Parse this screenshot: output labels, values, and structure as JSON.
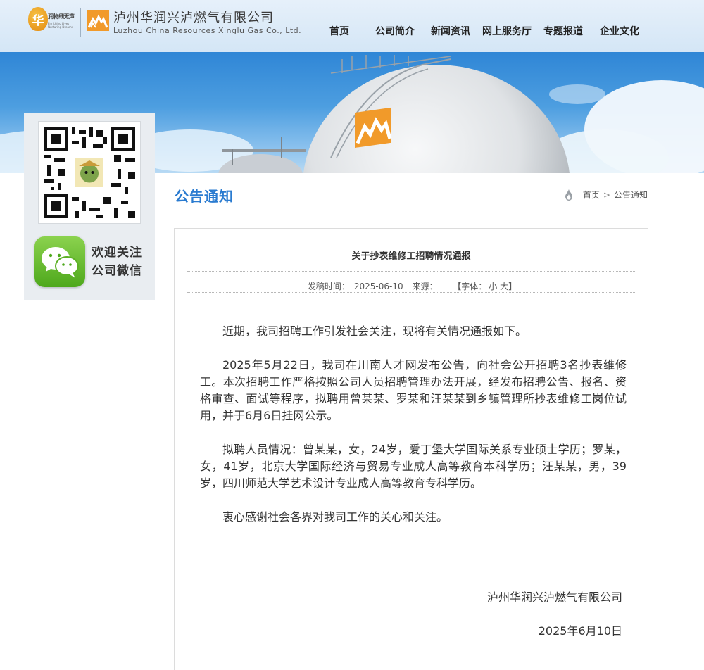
{
  "header": {
    "partner_logo_text": "润物细无声",
    "partner_logo_sub": "Enriching Lives Nurturing Dreams",
    "partner_badge_char": "华",
    "company_name_cn": "泸州华润兴泸燃气有限公司",
    "company_name_en": "Luzhou China Resources Xinglu Gas Co., Ltd.",
    "nav": [
      "首页",
      "公司简介",
      "新闻资讯",
      "网上服务厅",
      "专题报道",
      "企业文化"
    ]
  },
  "sidebar": {
    "wechat_line1": "欢迎关注",
    "wechat_line2": "公司微信"
  },
  "page": {
    "section_title": "公告通知",
    "breadcrumb": {
      "home": "首页",
      "separator": ">",
      "current": "公告通知"
    }
  },
  "article": {
    "title": "关于抄表维修工招聘情况通报",
    "meta": {
      "published_label": "发稿时间：",
      "published_date": "2025-06-10",
      "source_label": "来源：",
      "font_label": "【字体：",
      "font_small": "小",
      "font_large": "大】"
    },
    "paragraphs": [
      "近期，我司招聘工作引发社会关注，现将有关情况通报如下。",
      "2025年5月22日，我司在川南人才网发布公告，向社会公开招聘3名抄表维修工。本次招聘工作严格按照公司人员招聘管理办法开展，经发布招聘公告、报名、资格审查、面试等程序，拟聘用曾某某、罗某和汪某某到乡镇管理所抄表维修工岗位试用，并于6月6日挂网公示。",
      "拟聘人员情况：曾某某，女，24岁，爱丁堡大学国际关系专业硕士学历；罗某，女，41岁，北京大学国际经济与贸易专业成人高等教育本科学历；汪某某，男，39岁，四川师范大学艺术设计专业成人高等教育专科学历。",
      "衷心感谢社会各界对我司工作的关心和关注。"
    ],
    "signature_org": "泸州华润兴泸燃气有限公司",
    "signature_date": "2025年6月10日"
  },
  "colors": {
    "accent_blue": "#2a7bd0",
    "brand_orange": "#f19a2a",
    "header_bg": "#dde9f6",
    "wechat_green": "#4ea81c"
  },
  "icons": [
    "brand-logo-icon",
    "home-flame-icon",
    "qr-code-icon",
    "wechat-icon"
  ]
}
